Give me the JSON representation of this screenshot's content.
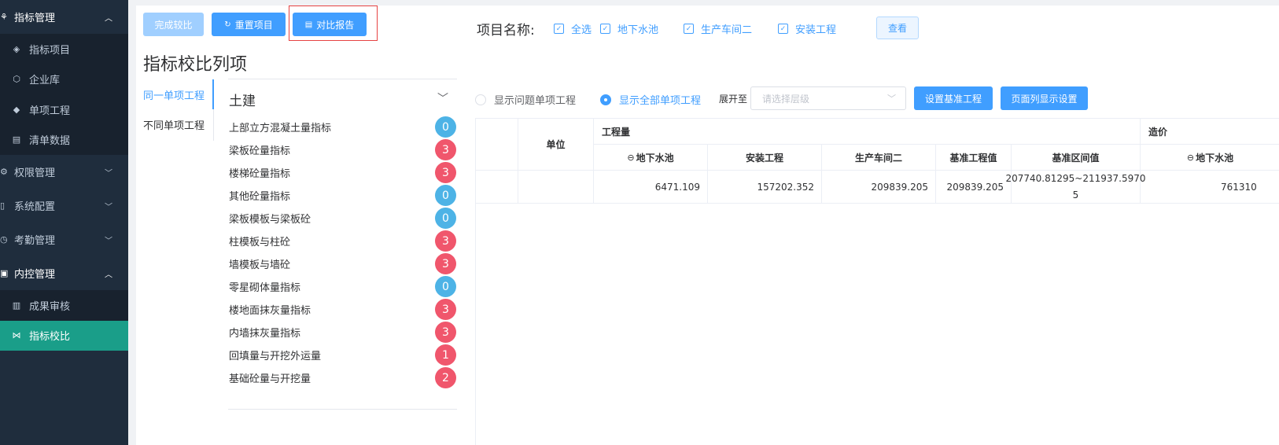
{
  "sidebar": {
    "groups": [
      {
        "label": "指标管理",
        "icon": "metrics-icon",
        "open": true
      },
      {
        "label": "权限管理",
        "icon": "permission-icon",
        "open": false
      },
      {
        "label": "系统配置",
        "icon": "config-icon",
        "open": false
      },
      {
        "label": "考勤管理",
        "icon": "attendance-icon",
        "open": false
      },
      {
        "label": "内控管理",
        "icon": "internal-control-icon",
        "open": true
      }
    ],
    "metrics_items": [
      {
        "label": "指标项目",
        "icon": "layers-icon"
      },
      {
        "label": "企业库",
        "icon": "box-icon"
      },
      {
        "label": "单项工程",
        "icon": "stack-icon"
      },
      {
        "label": "清单数据",
        "icon": "clipboard-icon"
      }
    ],
    "control_items": [
      {
        "label": "成果审核",
        "icon": "audit-icon"
      },
      {
        "label": "指标校比",
        "icon": "compare-icon",
        "active": true
      }
    ]
  },
  "toolbar": {
    "finish_label": "完成较比",
    "reset_label": "重置项目",
    "report_label": "对比报告"
  },
  "projects": {
    "label": "项目名称:",
    "options": [
      "全选",
      "地下水池",
      "生产车间二",
      "安装工程"
    ],
    "view_label": "查看"
  },
  "page_title": "指标校比列项",
  "vtabs": [
    "同一单项工程",
    "不同单项工程"
  ],
  "category": {
    "title": "土建",
    "items": [
      {
        "label": "上部立方混凝土量指标",
        "count": "0"
      },
      {
        "label": "梁板砼量指标",
        "count": "3"
      },
      {
        "label": "楼梯砼量指标",
        "count": "3"
      },
      {
        "label": "其他砼量指标",
        "count": "0"
      },
      {
        "label": "梁板模板与梁板砼",
        "count": "0"
      },
      {
        "label": "柱模板与柱砼",
        "count": "3"
      },
      {
        "label": "墙模板与墙砼",
        "count": "3"
      },
      {
        "label": "零星砌体量指标",
        "count": "0"
      },
      {
        "label": "楼地面抹灰量指标",
        "count": "3"
      },
      {
        "label": "内墙抹灰量指标",
        "count": "3"
      },
      {
        "label": "回填量与开挖外运量",
        "count": "1"
      },
      {
        "label": "基础砼量与开挖量",
        "count": "2"
      }
    ]
  },
  "filters": {
    "radio_problem": "显示问题单项工程",
    "radio_all": "显示全部单项工程",
    "expand_label": "展开至",
    "select_placeholder": "请选择层级",
    "set_base_label": "设置基准工程",
    "column_settings_label": "页面列显示设置"
  },
  "table": {
    "unit_header": "单位",
    "quantity_header": "工程量",
    "cost_header": "造价",
    "minus_sign": "⊖",
    "sub_headers": [
      "地下水池",
      "安装工程",
      "生产车间二",
      "基准工程值",
      "基准区间值",
      "地下水池"
    ],
    "row": {
      "underground_pool": "6471.109",
      "installation": "157202.352",
      "workshop2": "209839.205",
      "base_value": "209839.205",
      "base_range_line1": "207740.81295~211937.5970",
      "base_range_line2": "5",
      "cost_underground_pool": "761310"
    }
  }
}
